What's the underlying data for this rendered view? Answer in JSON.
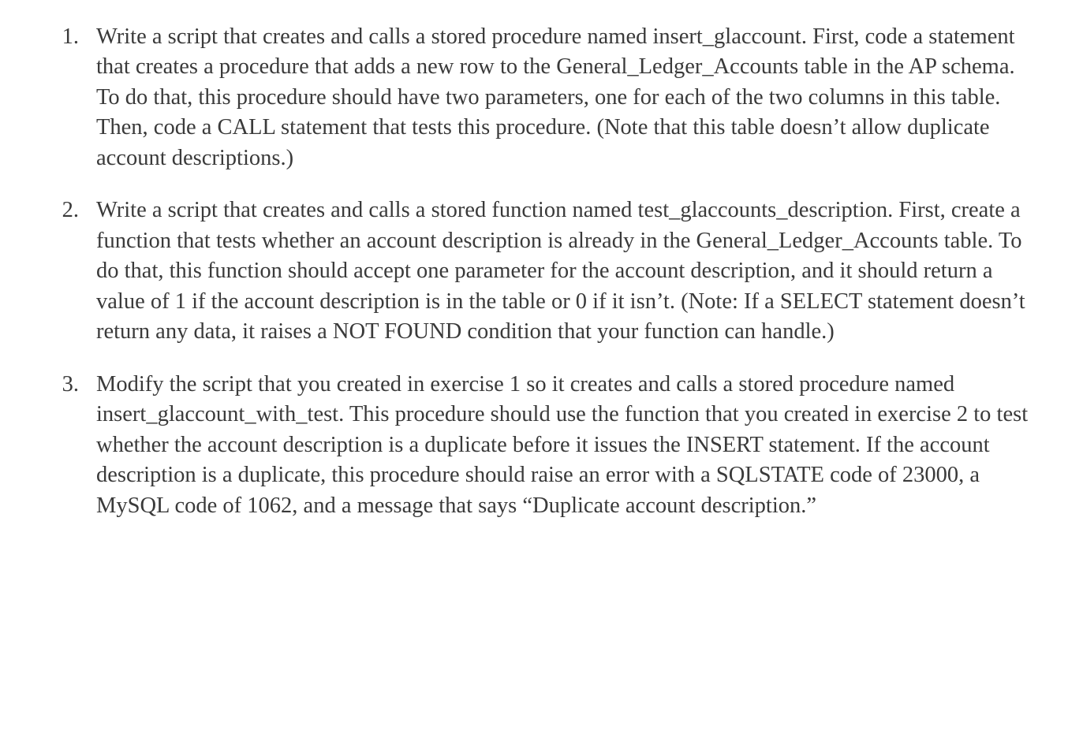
{
  "exercises": [
    {
      "number": "1.",
      "text": "Write a script that creates and calls a stored procedure named insert_glaccount. First, code a statement that creates a procedure that adds a new row to the General_Ledger_Accounts table in the AP schema. To do that, this procedure should have two parameters, one for each of the two columns in this table. Then, code a CALL statement that tests this procedure. (Note that this table doesn’t allow duplicate account descriptions.)"
    },
    {
      "number": "2.",
      "text": "Write a script that creates and calls a stored function named test_glaccounts_description. First, create a function that tests whether an account description is already in the General_Ledger_Accounts table. To do that, this function should accept one parameter for the account description, and it should return a value of 1 if the account description is in the table or 0 if it isn’t. (Note: If a SELECT statement doesn’t return any data, it raises a NOT FOUND condition that your function can handle.)"
    },
    {
      "number": "3.",
      "text": "Modify the script that you created in exercise 1 so it creates and calls a stored procedure named insert_glaccount_with_test. This procedure should use the function that you created in exercise 2 to test whether the account description is a duplicate before it issues the INSERT statement. If the account description is a duplicate, this procedure should raise an error with a SQLSTATE code of 23000, a MySQL code of 1062, and a message that says “Duplicate account description.”"
    }
  ]
}
